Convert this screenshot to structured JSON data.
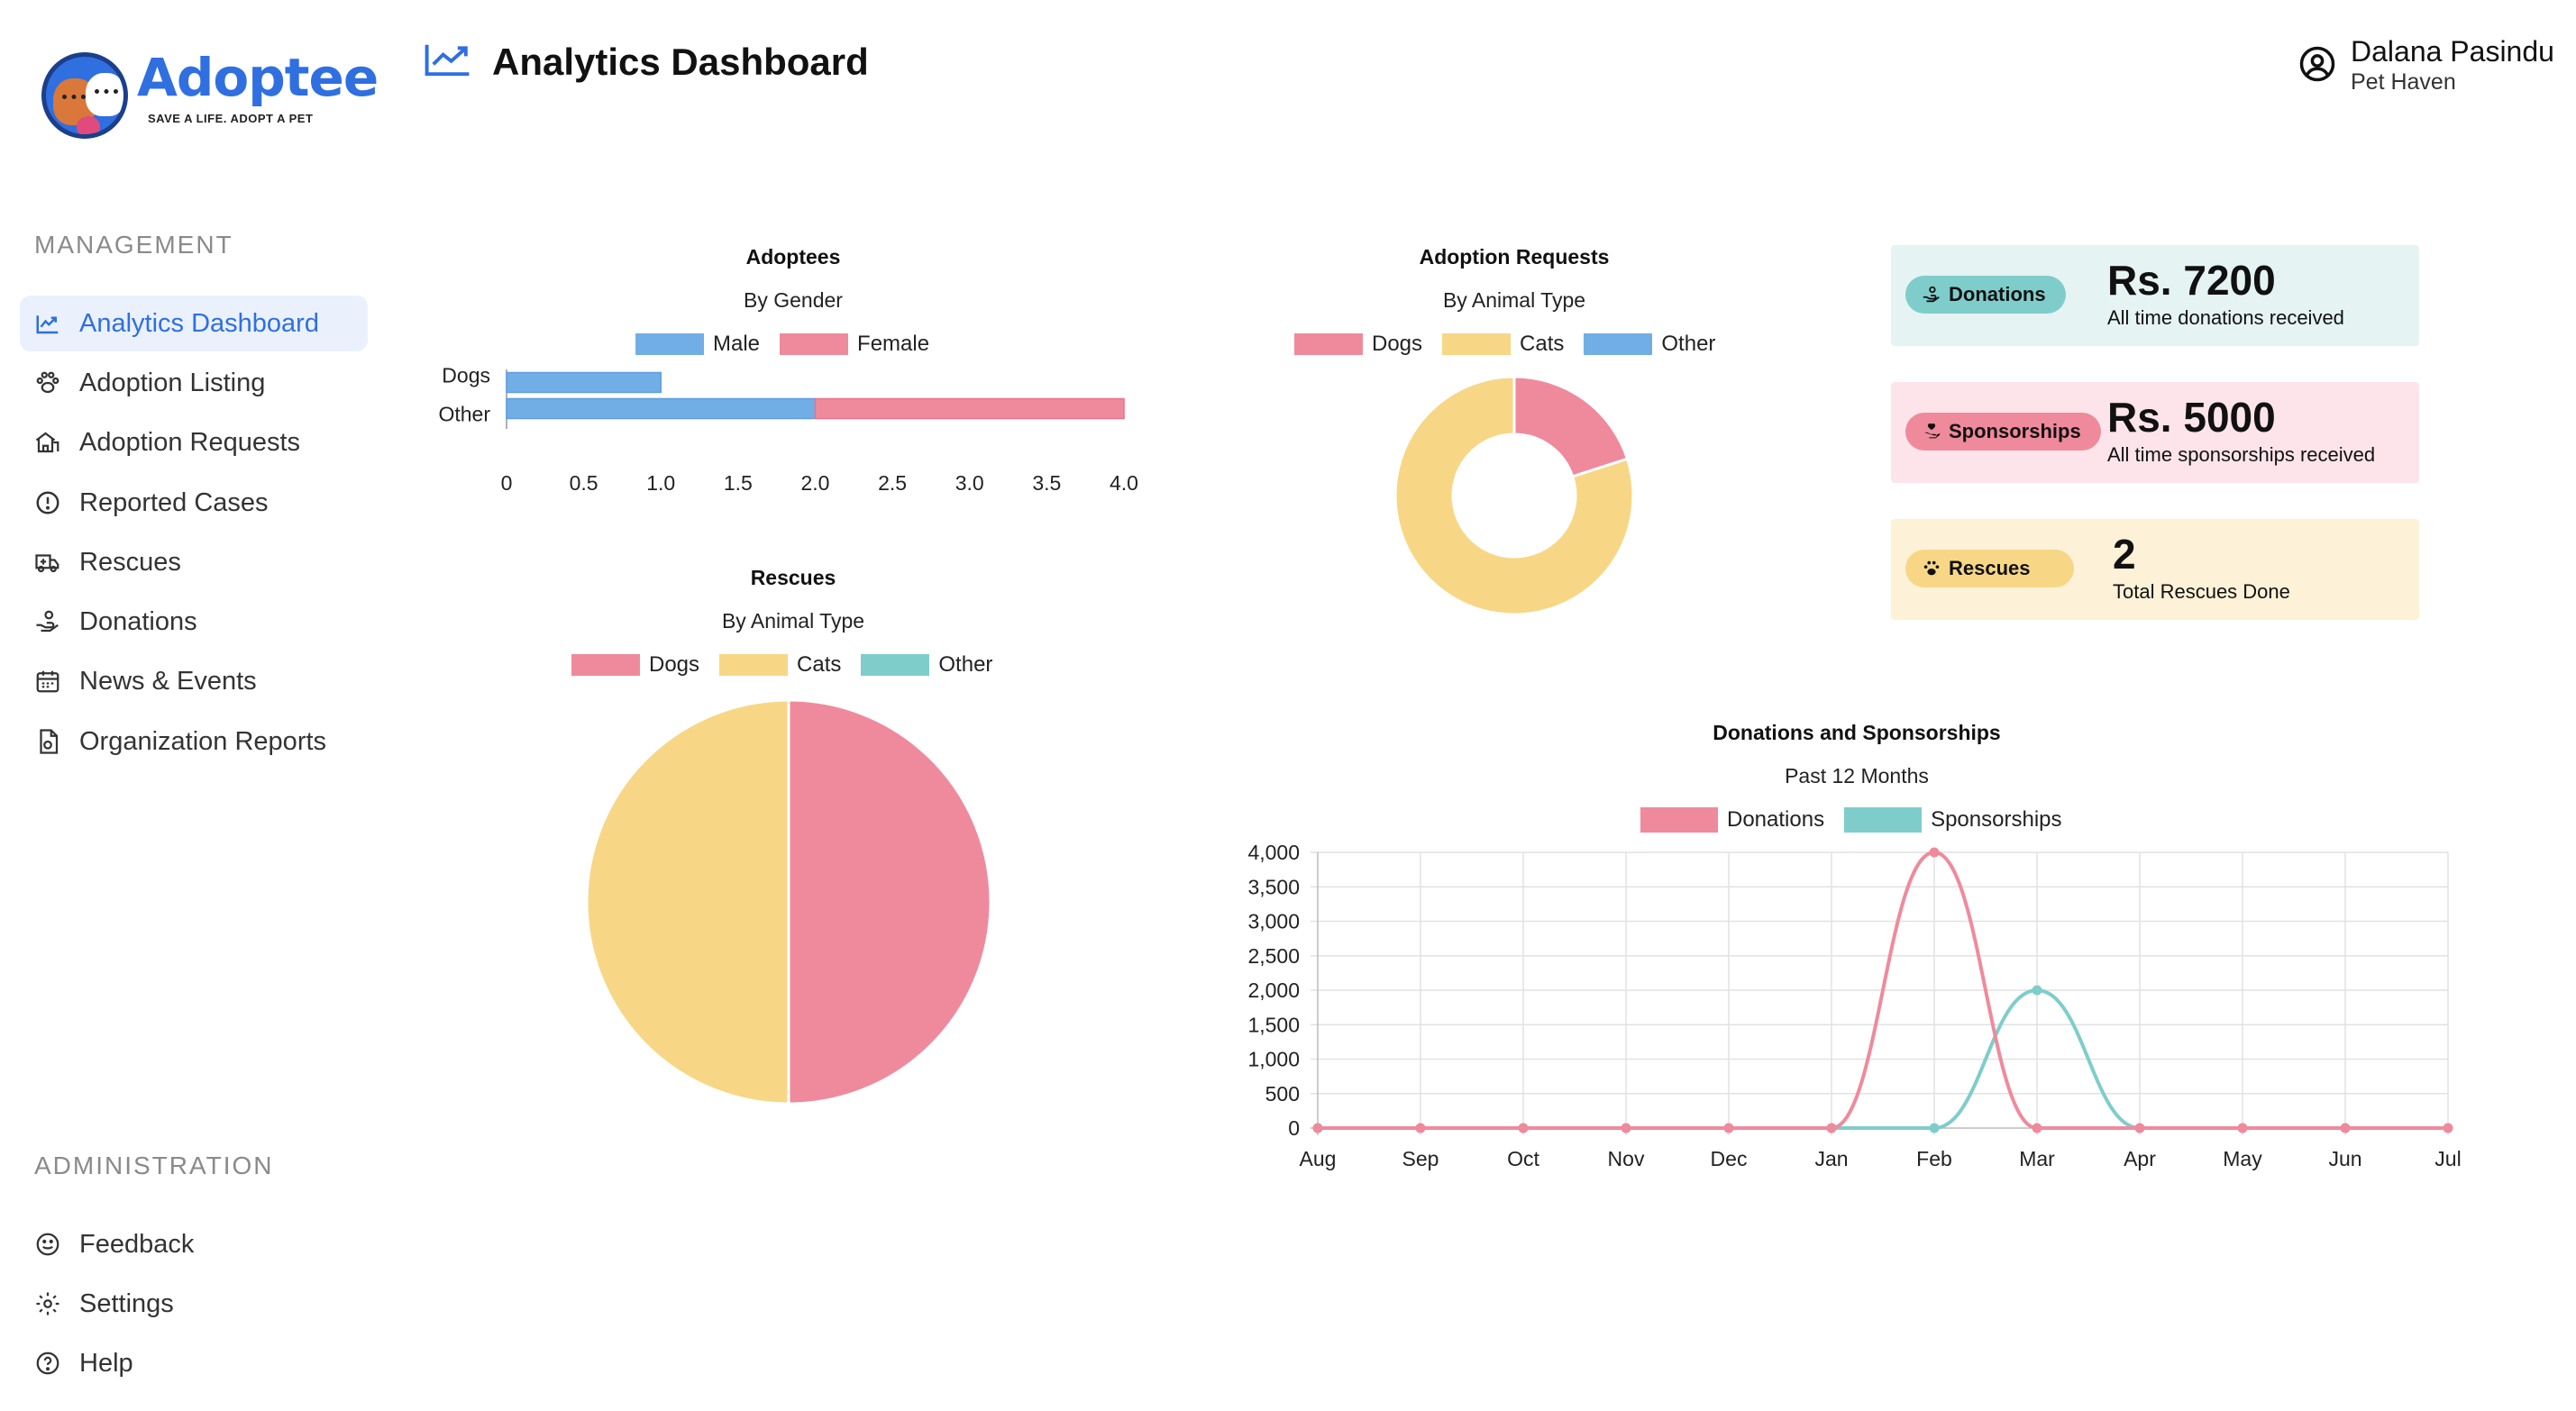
{
  "brand": {
    "name": "Adoptee",
    "tagline": "SAVE A LIFE.  ADOPT A PET"
  },
  "header": {
    "title": "Analytics Dashboard",
    "user_name": "Dalana Pasindu",
    "user_org": "Pet Haven"
  },
  "sidebar": {
    "management_title": "MANAGEMENT",
    "management_items": [
      {
        "label": "Analytics Dashboard",
        "icon": "trending-up-icon",
        "active": true
      },
      {
        "label": "Adoption Listing",
        "icon": "paw-icon"
      },
      {
        "label": "Adoption Requests",
        "icon": "dog-house-icon"
      },
      {
        "label": "Reported Cases",
        "icon": "alert-circle-icon"
      },
      {
        "label": "Rescues",
        "icon": "ambulance-icon"
      },
      {
        "label": "Donations",
        "icon": "hand-coin-icon"
      },
      {
        "label": "News & Events",
        "icon": "calendar-icon"
      },
      {
        "label": "Organization Reports",
        "icon": "document-icon"
      }
    ],
    "administration_title": "ADMINISTRATION",
    "administration_items": [
      {
        "label": "Feedback",
        "icon": "smiley-icon"
      },
      {
        "label": "Settings",
        "icon": "gear-icon"
      },
      {
        "label": "Help",
        "icon": "help-circle-icon"
      }
    ]
  },
  "colors": {
    "accent": "#2f6fe0",
    "male": "#72aee6",
    "female": "#ef8a9c",
    "dogs": "#ef8a9c",
    "cats": "#f7d786",
    "other_blue": "#72aee6",
    "other_teal": "#7ecdcb",
    "donations": "#ef8a9c",
    "sponsorships": "#7ecdcb"
  },
  "cards": [
    {
      "pill": "Donations",
      "value": "Rs. 7200",
      "desc": "All time donations received",
      "bg": "#e5f3f3",
      "pill_bg": "#7ecdcb",
      "icon": "hand-coin-icon"
    },
    {
      "pill": "Sponsorships",
      "value": "Rs. 5000",
      "desc": "All time sponsorships received",
      "bg": "#fde4ea",
      "pill_bg": "#ef8a9c",
      "icon": "hand-heart-icon"
    },
    {
      "pill": "Rescues",
      "value": "2",
      "desc": "Total Rescues Done",
      "bg": "#fdf2d8",
      "pill_bg": "#f7d786",
      "icon": "paw-icon"
    }
  ],
  "chart_data": [
    {
      "type": "bar",
      "orientation": "horizontal",
      "title": "Adoptees",
      "subtitle": "By Gender",
      "categories": [
        "Dogs",
        "Other"
      ],
      "series": [
        {
          "name": "Male",
          "values": [
            1,
            2
          ]
        },
        {
          "name": "Female",
          "values": [
            0,
            2
          ]
        }
      ],
      "stacked": true,
      "xlim": [
        0,
        4
      ],
      "xticks": [
        "0",
        "0.5",
        "1.0",
        "1.5",
        "2.0",
        "2.5",
        "3.0",
        "3.5",
        "4.0"
      ],
      "legend": "top"
    },
    {
      "type": "pie",
      "variant": "doughnut",
      "title": "Adoption Requests",
      "subtitle": "By Animal Type",
      "labels": [
        "Dogs",
        "Cats",
        "Other"
      ],
      "values": [
        1,
        4,
        0
      ],
      "legend": "top"
    },
    {
      "type": "pie",
      "title": "Rescues",
      "subtitle": "By Animal Type",
      "labels": [
        "Dogs",
        "Cats",
        "Other"
      ],
      "values": [
        1,
        1,
        0
      ],
      "legend": "top"
    },
    {
      "type": "line",
      "title": "Donations and Sponsorships",
      "subtitle": "Past 12 Months",
      "categories": [
        "Aug",
        "Sep",
        "Oct",
        "Nov",
        "Dec",
        "Jan",
        "Feb",
        "Mar",
        "Apr",
        "May",
        "Jun",
        "Jul"
      ],
      "series": [
        {
          "name": "Donations",
          "values": [
            0,
            0,
            0,
            0,
            0,
            0,
            4000,
            0,
            0,
            0,
            0,
            0
          ]
        },
        {
          "name": "Sponsorships",
          "values": [
            0,
            0,
            0,
            0,
            0,
            0,
            0,
            2000,
            0,
            0,
            0,
            0
          ]
        }
      ],
      "ylim": [
        0,
        4000
      ],
      "yticks": [
        "0",
        "500",
        "1,000",
        "1,500",
        "2,000",
        "2,500",
        "3,000",
        "3,500",
        "4,000"
      ],
      "grid": true,
      "legend": "top"
    }
  ]
}
